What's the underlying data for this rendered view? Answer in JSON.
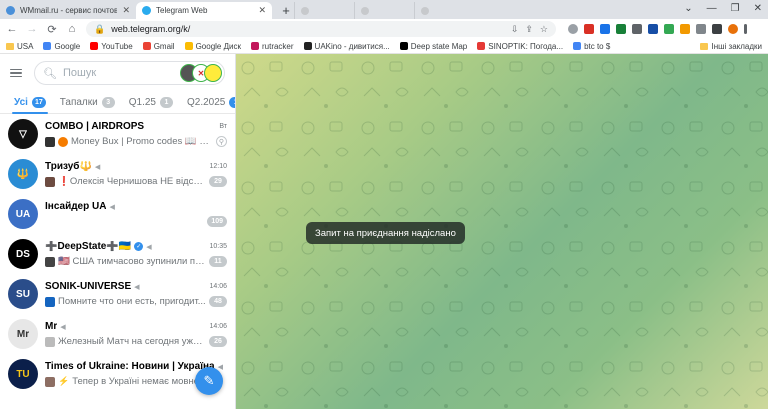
{
  "browser": {
    "tabs": [
      {
        "title": "WMmail.ru - сервис почтовых р",
        "favicon_color": "#4a90d9",
        "active": false
      },
      {
        "title": "Telegram Web",
        "favicon_color": "#2aabee",
        "active": true
      }
    ],
    "new_tab_icon": "plus-icon",
    "url": "web.telegram.org/k/",
    "bookmarks": [
      "USA",
      "Google",
      "YouTube",
      "Gmail",
      "Google Диск",
      "rutracker",
      "UAKino - дивитися...",
      "Deep state Map",
      "SINOPTIK: Погода...",
      "btc to $",
      "Інші закладки"
    ]
  },
  "sidebar": {
    "search_placeholder": "Пошук",
    "folders": [
      {
        "label": "Усі",
        "count": "17",
        "active": true
      },
      {
        "label": "Тапалки",
        "count": "3",
        "active": false
      },
      {
        "label": "Q1.25",
        "count": "1",
        "active": false
      },
      {
        "label": "Q2.2025",
        "count": "1",
        "active": false
      }
    ],
    "chats": [
      {
        "name": "COMBO | AIRDROPS",
        "time": "Вт",
        "message": "Money Bux | Promo codes 📖 KV...",
        "badge": "",
        "avatar_color": "#111111",
        "avatar_text": "▽",
        "pinned": true
      },
      {
        "name": "Тризуб🔱",
        "time": "12:10",
        "message": "❗Олексія Чернишова НЕ відсто...",
        "badge": "29",
        "avatar_color": "#2a8cd4",
        "avatar_text": "🔱",
        "pinned": false
      },
      {
        "name": "Інсайдер UA",
        "time": "",
        "message": "",
        "badge": "109",
        "avatar_color": "#3b6fc5",
        "avatar_text": "UA",
        "pinned": false
      },
      {
        "name": "➕DeepState➕🇺🇦",
        "time": "10:35",
        "message": "🇺🇸 США тимчасово зупинили по...",
        "badge": "11",
        "avatar_color": "#000000",
        "avatar_text": "DS",
        "pinned": false
      },
      {
        "name": "SONIK-UNIVERSE",
        "time": "14:06",
        "message": "Помните что они есть, пригодит...",
        "badge": "48",
        "avatar_color": "#2a4d8a",
        "avatar_text": "SU",
        "pinned": false
      },
      {
        "name": "Mr",
        "time": "14:06",
        "message": "Железный Матч на сегодня уже ...",
        "badge": "26",
        "avatar_color": "#e7e7e7",
        "avatar_text": "Mr",
        "pinned": false
      },
      {
        "name": "Times of Ukraine: Новини | Україна",
        "time": "",
        "message": "Тепер в Україні немає мовно...",
        "badge": "",
        "avatar_color": "#0b1f4a",
        "avatar_text": "TU",
        "pinned": false
      }
    ]
  },
  "main": {
    "toast": "Запит на приєднання надіслано",
    "background_colors": [
      "#cfd98a",
      "#7fb88a",
      "#cdd89a"
    ]
  }
}
